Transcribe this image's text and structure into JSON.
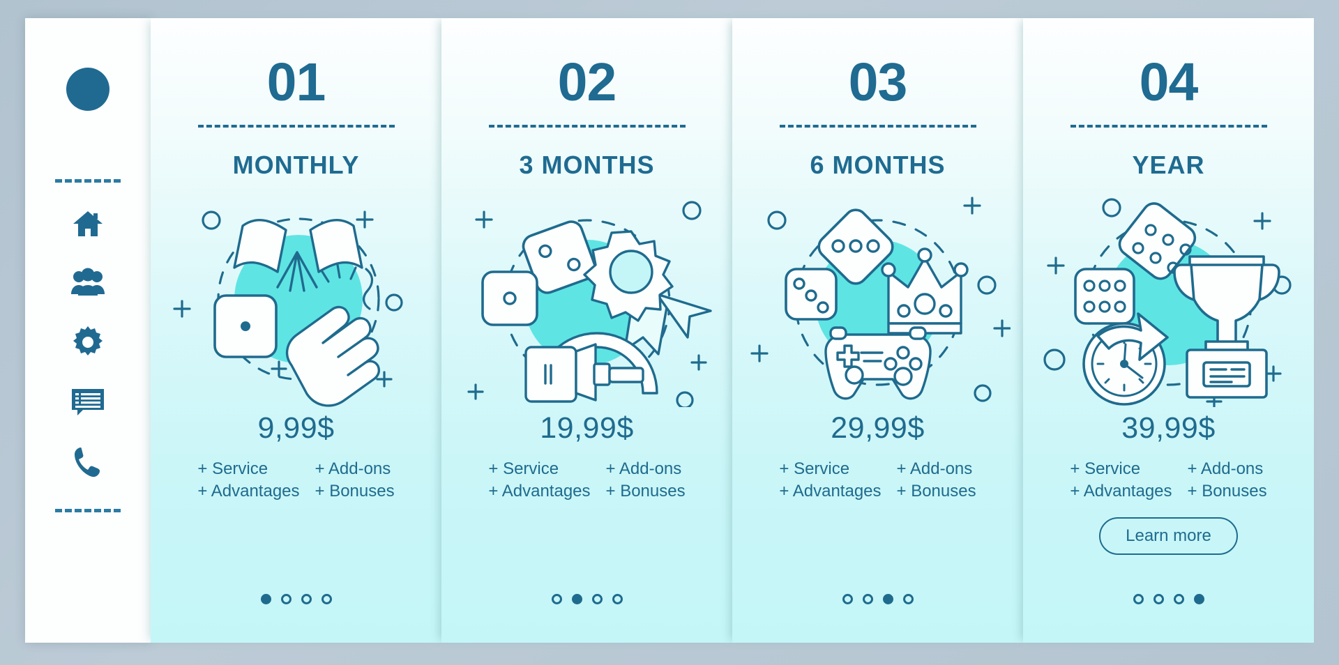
{
  "page": {
    "background_color": "#b7c7d3",
    "accent_color": "#1f6b8e",
    "illustration_fill": "#5fe4e4"
  },
  "sidebar": {
    "avatar": "avatar-circle",
    "divider_top": "dashed-divider",
    "divider_bottom": "dashed-divider",
    "items": [
      {
        "icon": "home-icon",
        "label": "Home"
      },
      {
        "icon": "users-icon",
        "label": "Users"
      },
      {
        "icon": "gear-icon",
        "label": "Settings"
      },
      {
        "icon": "chat-icon",
        "label": "Messages"
      },
      {
        "icon": "phone-icon",
        "label": "Call"
      }
    ]
  },
  "cards": [
    {
      "number": "01",
      "title": "MONTHLY",
      "price": "9,99$",
      "features": [
        "+ Service",
        "+ Add-ons",
        "+ Advantages",
        "+ Bonuses"
      ],
      "illustration": "party-flags-dice-clapping-hands",
      "cta": null,
      "dots": {
        "count": 4,
        "active_index": 0
      }
    },
    {
      "number": "02",
      "title": "3 MONTHS",
      "price": "19,99$",
      "features": [
        "+ Service",
        "+ Add-ons",
        "+ Advantages",
        "+ Bonuses"
      ],
      "illustration": "dice-award-rosette-vr-headset",
      "cta": null,
      "dots": {
        "count": 4,
        "active_index": 1
      }
    },
    {
      "number": "03",
      "title": "6 MONTHS",
      "price": "29,99$",
      "features": [
        "+ Service",
        "+ Add-ons",
        "+ Advantages",
        "+ Bonuses"
      ],
      "illustration": "dice-crown-gamepad",
      "cta": null,
      "dots": {
        "count": 4,
        "active_index": 2
      }
    },
    {
      "number": "04",
      "title": "YEAR",
      "price": "39,99$",
      "features": [
        "+ Service",
        "+ Add-ons",
        "+ Advantages",
        "+ Bonuses"
      ],
      "illustration": "dice-clock-trophy",
      "cta": "Learn more",
      "dots": {
        "count": 4,
        "active_index": 3
      }
    }
  ]
}
